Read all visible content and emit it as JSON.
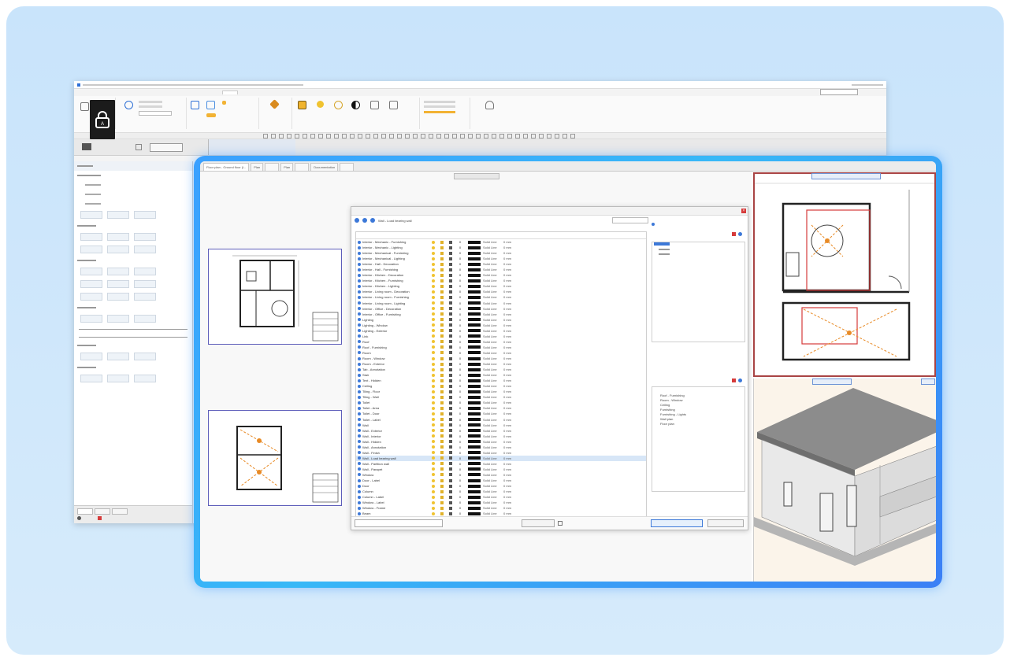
{
  "colors": {
    "card_bg": "#cfe7fb",
    "frame_glow": "#38b8f7",
    "accent_red": "#d63b3b",
    "swatch": "#111111",
    "selection": "#d7e6f7"
  },
  "back_window": {
    "menu_items": [
      "",
      "",
      "",
      "",
      "",
      "",
      "",
      "",
      "",
      "",
      "",
      ""
    ],
    "toolbar_icons": [
      "cursor-icon",
      "lock-icon",
      "layers-icon",
      "paint-icon",
      "cube-icon",
      "bulb-icon",
      "sun-icon",
      "contrast-icon",
      "grid-icon",
      "people-icon"
    ]
  },
  "front_window": {
    "doc_tabs": [
      {
        "label": "Floor plan - Ground floor (l..."
      },
      {
        "label": "Plan"
      },
      {
        "label": ""
      },
      {
        "label": "Plan"
      },
      {
        "label": ""
      },
      {
        "label": "Documentation"
      },
      {
        "label": ""
      }
    ]
  },
  "dialog": {
    "title": "",
    "toolbar_text": "Wall - Load bearing wall",
    "columns": [
      "",
      "",
      "",
      "",
      "",
      "",
      "",
      "",
      ""
    ],
    "layers": [
      {
        "name": "Interior - Mechanic - Furnishing",
        "col": "0",
        "lt": "Solid Line",
        "lw": "0 mm"
      },
      {
        "name": "Interior - Mechanic - Lighting",
        "col": "0",
        "lt": "Solid Line",
        "lw": "0 mm"
      },
      {
        "name": "Interior - Mechanical - Furnishing",
        "col": "0",
        "lt": "Solid Line",
        "lw": "0 mm"
      },
      {
        "name": "Interior - Mechanical - Lighting",
        "col": "0",
        "lt": "Solid Line",
        "lw": "0 mm"
      },
      {
        "name": "Interior - Hall - Decoration",
        "col": "0",
        "lt": "Solid Line",
        "lw": "0 mm"
      },
      {
        "name": "Interior - Hall - Furnishing",
        "col": "0",
        "lt": "Solid Line",
        "lw": "0 mm"
      },
      {
        "name": "Interior - Kitchen - Decoration",
        "col": "0",
        "lt": "Solid Line",
        "lw": "0 mm"
      },
      {
        "name": "Interior - Kitchen - Furnishing",
        "col": "0",
        "lt": "Solid Line",
        "lw": "0 mm"
      },
      {
        "name": "Interior - Kitchen - Lighting",
        "col": "0",
        "lt": "Solid Line",
        "lw": "0 mm"
      },
      {
        "name": "Interior - Living room - Decoration",
        "col": "0",
        "lt": "Solid Line",
        "lw": "0 mm"
      },
      {
        "name": "Interior - Living room - Furnishing",
        "col": "0",
        "lt": "Solid Line",
        "lw": "0 mm"
      },
      {
        "name": "Interior - Living room - Lighting",
        "col": "0",
        "lt": "Solid Line",
        "lw": "0 mm"
      },
      {
        "name": "Interior - Office - Decoration",
        "col": "0",
        "lt": "Solid Line",
        "lw": "0 mm"
      },
      {
        "name": "Interior - Office - Furnishing",
        "col": "0",
        "lt": "Solid Line",
        "lw": "0 mm"
      },
      {
        "name": "Lighting",
        "col": "0",
        "lt": "Solid Line",
        "lw": "0 mm"
      },
      {
        "name": "Lighting - Window",
        "col": "0",
        "lt": "Solid Line",
        "lw": "0 mm"
      },
      {
        "name": "Lighting - Exterior",
        "col": "0",
        "lt": "Solid Line",
        "lw": "0 mm"
      },
      {
        "name": "Link",
        "col": "0",
        "lt": "Solid Line",
        "lw": "0 mm"
      },
      {
        "name": "Roof",
        "col": "0",
        "lt": "Solid Line",
        "lw": "0 mm"
      },
      {
        "name": "Roof - Furnishing",
        "col": "0",
        "lt": "Solid Line",
        "lw": "0 mm"
      },
      {
        "name": "Room",
        "col": "0",
        "lt": "Solid Line",
        "lw": "0 mm"
      },
      {
        "name": "Room - Window",
        "col": "0",
        "lt": "Solid Line",
        "lw": "0 mm"
      },
      {
        "name": "Room - Exterior",
        "col": "0",
        "lt": "Solid Line",
        "lw": "0 mm"
      },
      {
        "name": "Tab - Annotation",
        "col": "0",
        "lt": "Solid Line",
        "lw": "0 mm"
      },
      {
        "name": "Stair",
        "col": "0",
        "lt": "Solid Line",
        "lw": "0 mm"
      },
      {
        "name": "Text - Hidden",
        "col": "0",
        "lt": "Solid Line",
        "lw": "0 mm"
      },
      {
        "name": "Ceiling",
        "col": "0",
        "lt": "Solid Line",
        "lw": "0 mm"
      },
      {
        "name": "Tiling - Floor",
        "col": "0",
        "lt": "Solid Line",
        "lw": "0 mm"
      },
      {
        "name": "Tiling - Wall",
        "col": "0",
        "lt": "Solid Line",
        "lw": "0 mm"
      },
      {
        "name": "Toilet",
        "col": "0",
        "lt": "Solid Line",
        "lw": "0 mm"
      },
      {
        "name": "Toilet - Area",
        "col": "0",
        "lt": "Solid Line",
        "lw": "0 mm"
      },
      {
        "name": "Toilet - Door",
        "col": "0",
        "lt": "Solid Line",
        "lw": "0 mm"
      },
      {
        "name": "Toilet - Label",
        "col": "0",
        "lt": "Solid Line",
        "lw": "0 mm"
      },
      {
        "name": "Wall",
        "col": "0",
        "lt": "Solid Line",
        "lw": "0 mm"
      },
      {
        "name": "Wall - Exterior",
        "col": "0",
        "lt": "Solid Line",
        "lw": "0 mm"
      },
      {
        "name": "Wall - Interior",
        "col": "0",
        "lt": "Solid Line",
        "lw": "0 mm"
      },
      {
        "name": "Wall - Hidden",
        "col": "0",
        "lt": "Solid Line",
        "lw": "0 mm"
      },
      {
        "name": "Wall - Annotation",
        "col": "0",
        "lt": "Solid Line",
        "lw": "0 mm"
      },
      {
        "name": "Wall - Finish",
        "col": "0",
        "lt": "Solid Line",
        "lw": "0 mm"
      },
      {
        "name": "Wall - Load bearing wall",
        "col": "0",
        "lt": "Solid Line",
        "lw": "0 mm"
      },
      {
        "name": "Wall - Partition wall",
        "col": "0",
        "lt": "Solid Line",
        "lw": "0 mm"
      },
      {
        "name": "Wall - Parapet",
        "col": "0",
        "lt": "Solid Line",
        "lw": "0 mm"
      },
      {
        "name": "Window",
        "col": "0",
        "lt": "Solid Line",
        "lw": "0 mm"
      },
      {
        "name": "Door - Label",
        "col": "0",
        "lt": "Solid Line",
        "lw": "0 mm"
      },
      {
        "name": "Door",
        "col": "0",
        "lt": "Solid Line",
        "lw": "0 mm"
      },
      {
        "name": "Column",
        "col": "0",
        "lt": "Solid Line",
        "lw": "0 mm"
      },
      {
        "name": "Column - Label",
        "col": "0",
        "lt": "Solid Line",
        "lw": "0 mm"
      },
      {
        "name": "Window - Label",
        "col": "0",
        "lt": "Solid Line",
        "lw": "0 mm"
      },
      {
        "name": "Window - Frame",
        "col": "0",
        "lt": "Solid Line",
        "lw": "0 mm"
      },
      {
        "name": "Beam",
        "col": "0",
        "lt": "Solid Line",
        "lw": "0 mm"
      }
    ],
    "selected_index": 39,
    "right_top_items": [
      "",
      "",
      ""
    ],
    "right_bottom_items": [
      "",
      "Roof - Furnishing",
      "Room - Window",
      "Ceiling",
      "Furnishing",
      "Furnishing - Lights",
      "Wall plan",
      "Floor plan",
      ""
    ],
    "footer": {
      "filter_label": "",
      "btn_settings": "",
      "check_label": "",
      "btn_ok": "",
      "btn_cancel": ""
    }
  }
}
